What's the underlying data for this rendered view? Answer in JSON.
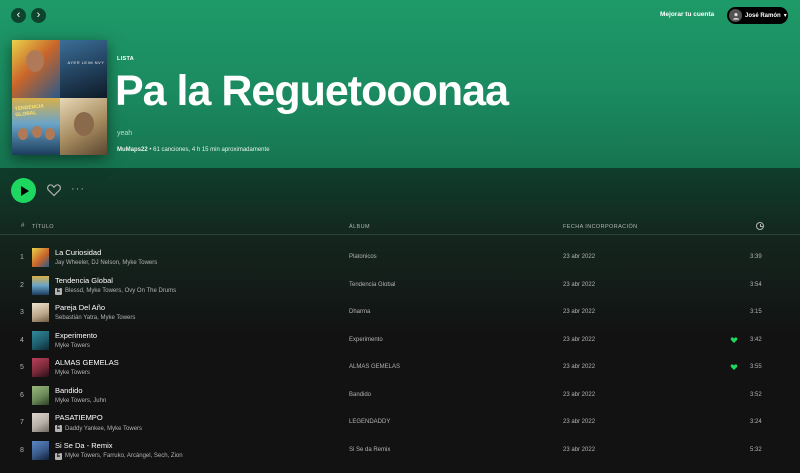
{
  "topbar": {
    "upgrade_label": "Mejorar tu cuenta",
    "user_name": "José Ramón"
  },
  "playlist": {
    "type": "LISTA",
    "title": "Pa la Reguetooonaa",
    "description": "yeah",
    "owner": "MuMaps22",
    "meta": " • 61 canciones, 4 h 15 min aproximadamente",
    "cover_text_1": "AYER LEIM NVY",
    "cover_text_2": "TENDENCIA GLOBAL"
  },
  "table_header": {
    "num": "#",
    "title": "TÍTULO",
    "album": "ÁLBUM",
    "date": "FECHA INCORPORACIÓN"
  },
  "colors": {
    "accent": "#1ed760",
    "hero_top": "#1e9a68",
    "background": "#121212"
  },
  "tracks": [
    {
      "idx": "1",
      "title": "La Curiosidad",
      "explicit": false,
      "artists": "Jay Wheeler, DJ Nelson, Myke Towers",
      "album": "Platonicos",
      "date": "23 abr 2022",
      "liked": false,
      "duration": "3:39",
      "thumb_color": "#c9a64a"
    },
    {
      "idx": "2",
      "title": "Tendencia Global",
      "explicit": true,
      "artists": "Blessd, Myke Towers, Ovy On The Drums",
      "album": "Tendencia Global",
      "date": "23 abr 2022",
      "liked": false,
      "duration": "3:54",
      "thumb_color": "#6aa0c8"
    },
    {
      "idx": "3",
      "title": "Pareja Del Año",
      "explicit": false,
      "artists": "Sebastián Yatra, Myke Towers",
      "album": "Dharma",
      "date": "23 abr 2022",
      "liked": false,
      "duration": "3:15",
      "thumb_color": "#d9c9a8"
    },
    {
      "idx": "4",
      "title": "Experimento",
      "explicit": false,
      "artists": "Myke Towers",
      "album": "Experimento",
      "date": "23 abr 2022",
      "liked": true,
      "duration": "3:42",
      "thumb_color": "#1f5e6e"
    },
    {
      "idx": "5",
      "title": "ALMAS GEMELAS",
      "explicit": false,
      "artists": "Myke Towers",
      "album": "ALMAS GEMELAS",
      "date": "23 abr 2022",
      "liked": true,
      "duration": "3:55",
      "thumb_color": "#7a2a3a"
    },
    {
      "idx": "6",
      "title": "Bandido",
      "explicit": false,
      "artists": "Myke Towers, Juhn",
      "album": "Bandido",
      "date": "23 abr 2022",
      "liked": false,
      "duration": "3:52",
      "thumb_color": "#6a8a5a"
    },
    {
      "idx": "7",
      "title": "PASATIEMPO",
      "explicit": true,
      "artists": "Daddy Yankee, Myke Towers",
      "album": "LEGENDADDY",
      "date": "23 abr 2022",
      "liked": false,
      "duration": "3:24",
      "thumb_color": "#b8b0a8"
    },
    {
      "idx": "8",
      "title": "Si Se Da - Remix",
      "explicit": true,
      "artists": "Myke Towers, Farruko, Arcángel, Sech, Zion",
      "album": "Si Se da Remix",
      "date": "23 abr 2022",
      "liked": false,
      "duration": "5:32",
      "thumb_color": "#3a5a8a"
    }
  ]
}
